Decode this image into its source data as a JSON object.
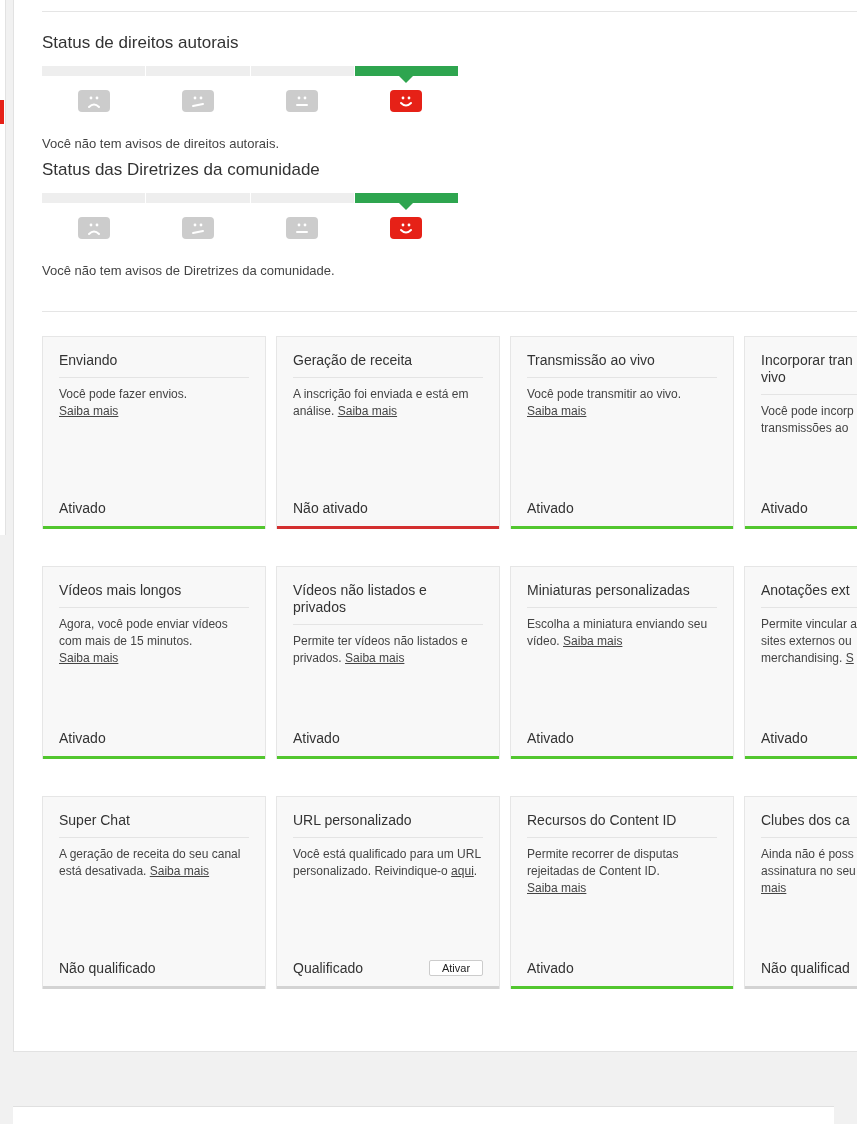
{
  "sidebar": {
    "active_marker": true
  },
  "strike_sections": [
    {
      "title": "Status de direitos autorais",
      "segments": [
        {
          "kind": "sad",
          "selected": false
        },
        {
          "kind": "doubtful",
          "selected": false
        },
        {
          "kind": "neutral",
          "selected": false
        },
        {
          "kind": "happy",
          "selected": true
        }
      ],
      "message": "Você não tem avisos de direitos autorais."
    },
    {
      "title": "Status das Diretrizes da comunidade",
      "segments": [
        {
          "kind": "sad",
          "selected": false
        },
        {
          "kind": "doubtful",
          "selected": false
        },
        {
          "kind": "neutral",
          "selected": false
        },
        {
          "kind": "happy",
          "selected": true
        }
      ],
      "message": "Você não tem avisos de Diretrizes da comunidade."
    }
  ],
  "feature_rows": [
    [
      {
        "title": "Enviando",
        "text": "Você pode fazer envios. ",
        "link": "Saiba mais",
        "status": "Ativado",
        "kind": "on"
      },
      {
        "title": "Geração de receita",
        "text": "A inscrição foi enviada e está em análise. ",
        "link": "Saiba mais",
        "status": "Não ativado",
        "kind": "off"
      },
      {
        "title": "Transmissão ao vivo",
        "text": "Você pode transmitir ao vivo. ",
        "link": "Saiba mais",
        "status": "Ativado",
        "kind": "on"
      },
      {
        "title": "Incorporar tran\nvivo",
        "text": "Você pode incorp\ntransmissões ao",
        "status": "Ativado",
        "kind": "on"
      }
    ],
    [
      {
        "title": "Vídeos mais longos",
        "text": "Agora, você pode enviar vídeos com mais de 15 minutos. ",
        "link": "Saiba mais",
        "status": "Ativado",
        "kind": "on"
      },
      {
        "title": "Vídeos não listados e privados",
        "text": "Permite ter vídeos não listados e privados. ",
        "link": "Saiba mais",
        "status": "Ativado",
        "kind": "on"
      },
      {
        "title": "Miniaturas personalizadas",
        "text": "Escolha a miniatura enviando seu vídeo. ",
        "link": "Saiba mais",
        "status": "Ativado",
        "kind": "on"
      },
      {
        "title": "Anotações ext",
        "text": "Permite vincular a\nsites externos ou\nmerchandising. ",
        "link": "S",
        "status": "Ativado",
        "kind": "on"
      }
    ],
    [
      {
        "title": "Super Chat",
        "text": "A geração de receita do seu canal está desativada. ",
        "link": "Saiba mais",
        "status": "Não qualificado",
        "kind": "na"
      },
      {
        "title": "URL personalizado",
        "text": "Você está qualificado para um URL personalizado. Reivindique-o ",
        "link": "aqui",
        "after": ".",
        "status": "Qualificado",
        "kind": "na",
        "button": "Ativar"
      },
      {
        "title": "Recursos do Content ID",
        "text": "Permite recorrer de disputas rejeitadas de Content ID. ",
        "link": "Saiba mais",
        "status": "Ativado",
        "kind": "on"
      },
      {
        "title": "Clubes dos ca",
        "text": "Ainda não é poss\nassinatura no seu\n",
        "link": "mais",
        "status": "Não qualificad",
        "kind": "na"
      }
    ]
  ]
}
